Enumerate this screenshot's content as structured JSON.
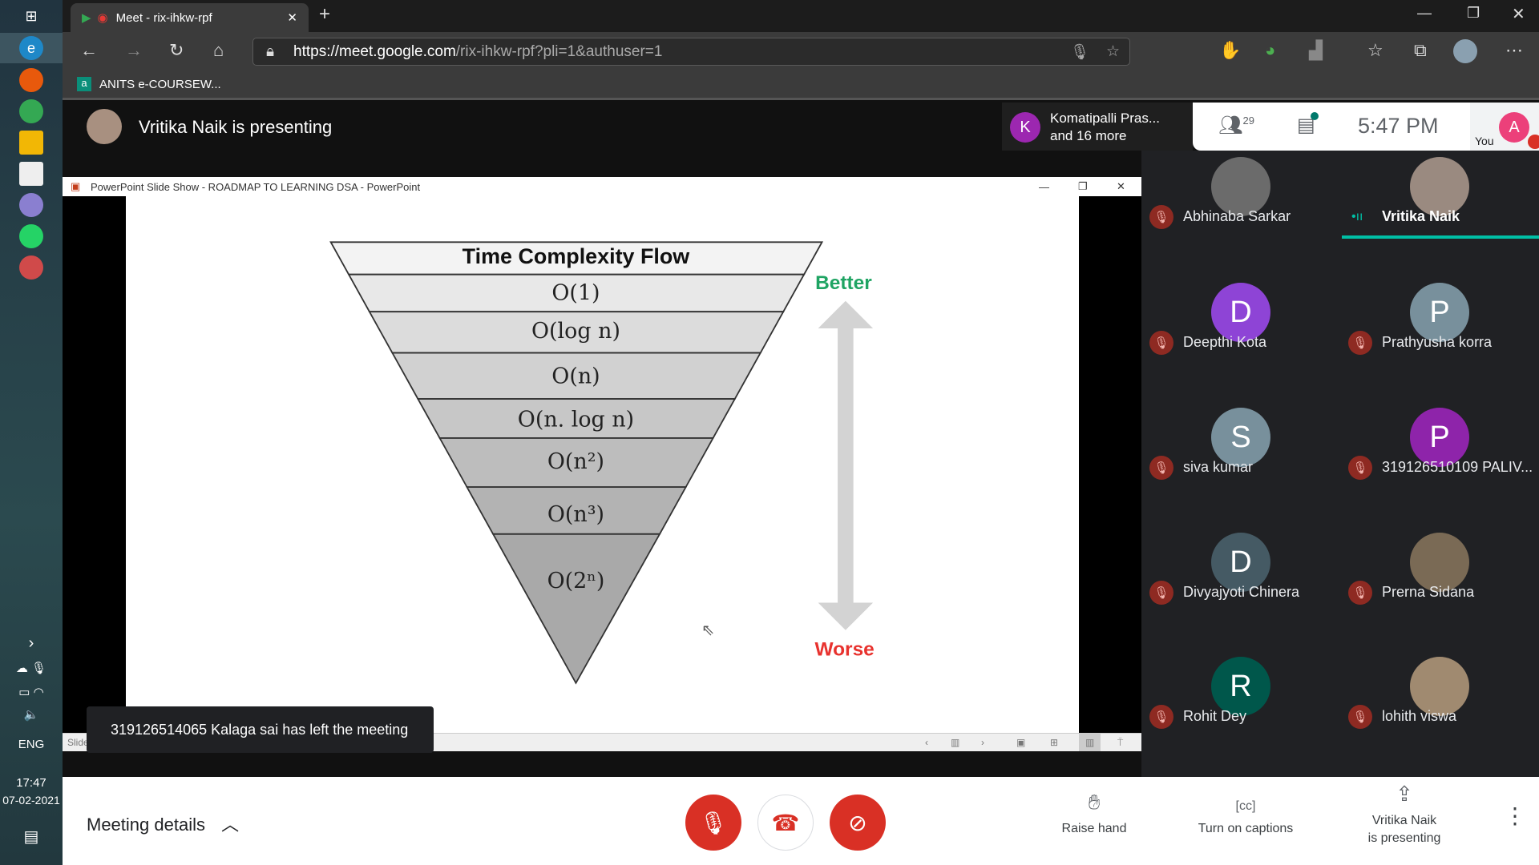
{
  "taskbar": {
    "lang": "ENG",
    "time": "17:47",
    "date": "07-02-2021"
  },
  "browser": {
    "tab_title": "Meet - rix-ihkw-rpf",
    "url_domain": "https://meet.google.com",
    "url_path": "/rix-ihkw-rpf?pli=1&authuser=1",
    "bookmark": "ANITS e-COURSEW..."
  },
  "meet": {
    "presenting_title": "Vritika Naik is presenting",
    "others_line1": "Komatipalli Pras...",
    "others_line2": "and 16 more",
    "others_avatar": "K",
    "participant_count": "29",
    "clock": "5:47 PM",
    "you_label": "You",
    "you_avatar": "A",
    "toast": "319126514065 Kalaga sai has left the meeting",
    "meeting_details": "Meeting details",
    "raise_hand": "Raise hand",
    "captions": "Turn on captions",
    "presenting_line1": "Vritika Naik",
    "presenting_line2": "is presenting",
    "accent": "#00bfa5",
    "danger": "#d93025"
  },
  "participants": [
    {
      "name": "Abhinaba Sarkar",
      "avatar": "",
      "color": "#6b6b6b",
      "muted": true
    },
    {
      "name": "Vritika Naik",
      "avatar": "",
      "color": "#9a8a80",
      "muted": false,
      "speaking": true
    },
    {
      "name": "Deepthi Kota",
      "avatar": "D",
      "color": "#8e44d6",
      "muted": true
    },
    {
      "name": "Prathyusha korra",
      "avatar": "P",
      "color": "#78909c",
      "muted": true
    },
    {
      "name": "siva kumar",
      "avatar": "S",
      "color": "#78909c",
      "muted": true
    },
    {
      "name": "319126510109 PALIV...",
      "avatar": "P",
      "color": "#8e24aa",
      "muted": true
    },
    {
      "name": "Divyajyoti Chinera",
      "avatar": "D",
      "color": "#455a64",
      "muted": true
    },
    {
      "name": "Prerna Sidana",
      "avatar": "",
      "color": "#7a6a55",
      "muted": true
    },
    {
      "name": "Rohit Dey",
      "avatar": "R",
      "color": "#00574b",
      "muted": true
    },
    {
      "name": "lohith viswa",
      "avatar": "",
      "color": "#a08a70",
      "muted": true
    }
  ],
  "ppt": {
    "window_title": "PowerPoint Slide Show  -  ROADMAP TO LEARNING DSA - PowerPoint",
    "status": "Slide"
  },
  "slide": {
    "title": "Time Complexity Flow",
    "levels": [
      "O(1)",
      "O(log n)",
      "O(n)",
      "O(n. log n)",
      "O(n²)",
      "O(n³)",
      "O(2ⁿ)"
    ],
    "better": "Better",
    "worse": "Worse",
    "better_color": "#1fa463",
    "worse_color": "#e8322e"
  }
}
